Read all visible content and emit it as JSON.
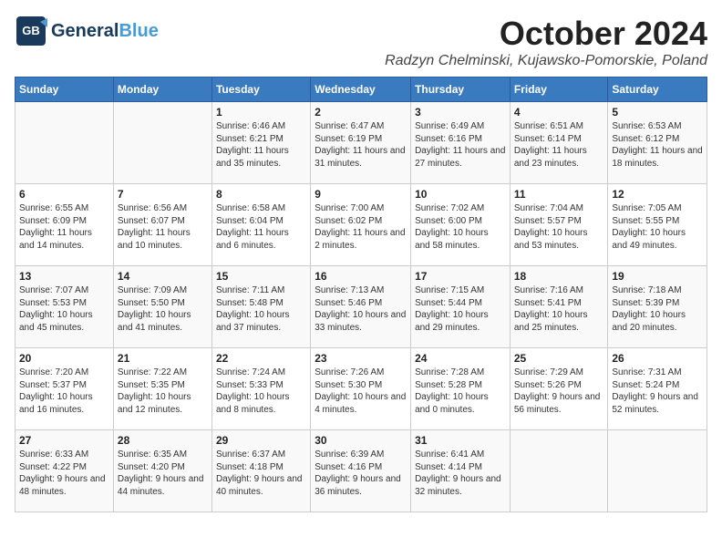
{
  "header": {
    "logo_general": "General",
    "logo_blue": "Blue",
    "main_title": "October 2024",
    "subtitle": "Radzyn Chelminski, Kujawsko-Pomorskie, Poland"
  },
  "days_of_week": [
    "Sunday",
    "Monday",
    "Tuesday",
    "Wednesday",
    "Thursday",
    "Friday",
    "Saturday"
  ],
  "weeks": [
    [
      {
        "day": "",
        "sunrise": "",
        "sunset": "",
        "daylight": ""
      },
      {
        "day": "",
        "sunrise": "",
        "sunset": "",
        "daylight": ""
      },
      {
        "day": "1",
        "sunrise": "Sunrise: 6:46 AM",
        "sunset": "Sunset: 6:21 PM",
        "daylight": "Daylight: 11 hours and 35 minutes."
      },
      {
        "day": "2",
        "sunrise": "Sunrise: 6:47 AM",
        "sunset": "Sunset: 6:19 PM",
        "daylight": "Daylight: 11 hours and 31 minutes."
      },
      {
        "day": "3",
        "sunrise": "Sunrise: 6:49 AM",
        "sunset": "Sunset: 6:16 PM",
        "daylight": "Daylight: 11 hours and 27 minutes."
      },
      {
        "day": "4",
        "sunrise": "Sunrise: 6:51 AM",
        "sunset": "Sunset: 6:14 PM",
        "daylight": "Daylight: 11 hours and 23 minutes."
      },
      {
        "day": "5",
        "sunrise": "Sunrise: 6:53 AM",
        "sunset": "Sunset: 6:12 PM",
        "daylight": "Daylight: 11 hours and 18 minutes."
      }
    ],
    [
      {
        "day": "6",
        "sunrise": "Sunrise: 6:55 AM",
        "sunset": "Sunset: 6:09 PM",
        "daylight": "Daylight: 11 hours and 14 minutes."
      },
      {
        "day": "7",
        "sunrise": "Sunrise: 6:56 AM",
        "sunset": "Sunset: 6:07 PM",
        "daylight": "Daylight: 11 hours and 10 minutes."
      },
      {
        "day": "8",
        "sunrise": "Sunrise: 6:58 AM",
        "sunset": "Sunset: 6:04 PM",
        "daylight": "Daylight: 11 hours and 6 minutes."
      },
      {
        "day": "9",
        "sunrise": "Sunrise: 7:00 AM",
        "sunset": "Sunset: 6:02 PM",
        "daylight": "Daylight: 11 hours and 2 minutes."
      },
      {
        "day": "10",
        "sunrise": "Sunrise: 7:02 AM",
        "sunset": "Sunset: 6:00 PM",
        "daylight": "Daylight: 10 hours and 58 minutes."
      },
      {
        "day": "11",
        "sunrise": "Sunrise: 7:04 AM",
        "sunset": "Sunset: 5:57 PM",
        "daylight": "Daylight: 10 hours and 53 minutes."
      },
      {
        "day": "12",
        "sunrise": "Sunrise: 7:05 AM",
        "sunset": "Sunset: 5:55 PM",
        "daylight": "Daylight: 10 hours and 49 minutes."
      }
    ],
    [
      {
        "day": "13",
        "sunrise": "Sunrise: 7:07 AM",
        "sunset": "Sunset: 5:53 PM",
        "daylight": "Daylight: 10 hours and 45 minutes."
      },
      {
        "day": "14",
        "sunrise": "Sunrise: 7:09 AM",
        "sunset": "Sunset: 5:50 PM",
        "daylight": "Daylight: 10 hours and 41 minutes."
      },
      {
        "day": "15",
        "sunrise": "Sunrise: 7:11 AM",
        "sunset": "Sunset: 5:48 PM",
        "daylight": "Daylight: 10 hours and 37 minutes."
      },
      {
        "day": "16",
        "sunrise": "Sunrise: 7:13 AM",
        "sunset": "Sunset: 5:46 PM",
        "daylight": "Daylight: 10 hours and 33 minutes."
      },
      {
        "day": "17",
        "sunrise": "Sunrise: 7:15 AM",
        "sunset": "Sunset: 5:44 PM",
        "daylight": "Daylight: 10 hours and 29 minutes."
      },
      {
        "day": "18",
        "sunrise": "Sunrise: 7:16 AM",
        "sunset": "Sunset: 5:41 PM",
        "daylight": "Daylight: 10 hours and 25 minutes."
      },
      {
        "day": "19",
        "sunrise": "Sunrise: 7:18 AM",
        "sunset": "Sunset: 5:39 PM",
        "daylight": "Daylight: 10 hours and 20 minutes."
      }
    ],
    [
      {
        "day": "20",
        "sunrise": "Sunrise: 7:20 AM",
        "sunset": "Sunset: 5:37 PM",
        "daylight": "Daylight: 10 hours and 16 minutes."
      },
      {
        "day": "21",
        "sunrise": "Sunrise: 7:22 AM",
        "sunset": "Sunset: 5:35 PM",
        "daylight": "Daylight: 10 hours and 12 minutes."
      },
      {
        "day": "22",
        "sunrise": "Sunrise: 7:24 AM",
        "sunset": "Sunset: 5:33 PM",
        "daylight": "Daylight: 10 hours and 8 minutes."
      },
      {
        "day": "23",
        "sunrise": "Sunrise: 7:26 AM",
        "sunset": "Sunset: 5:30 PM",
        "daylight": "Daylight: 10 hours and 4 minutes."
      },
      {
        "day": "24",
        "sunrise": "Sunrise: 7:28 AM",
        "sunset": "Sunset: 5:28 PM",
        "daylight": "Daylight: 10 hours and 0 minutes."
      },
      {
        "day": "25",
        "sunrise": "Sunrise: 7:29 AM",
        "sunset": "Sunset: 5:26 PM",
        "daylight": "Daylight: 9 hours and 56 minutes."
      },
      {
        "day": "26",
        "sunrise": "Sunrise: 7:31 AM",
        "sunset": "Sunset: 5:24 PM",
        "daylight": "Daylight: 9 hours and 52 minutes."
      }
    ],
    [
      {
        "day": "27",
        "sunrise": "Sunrise: 6:33 AM",
        "sunset": "Sunset: 4:22 PM",
        "daylight": "Daylight: 9 hours and 48 minutes."
      },
      {
        "day": "28",
        "sunrise": "Sunrise: 6:35 AM",
        "sunset": "Sunset: 4:20 PM",
        "daylight": "Daylight: 9 hours and 44 minutes."
      },
      {
        "day": "29",
        "sunrise": "Sunrise: 6:37 AM",
        "sunset": "Sunset: 4:18 PM",
        "daylight": "Daylight: 9 hours and 40 minutes."
      },
      {
        "day": "30",
        "sunrise": "Sunrise: 6:39 AM",
        "sunset": "Sunset: 4:16 PM",
        "daylight": "Daylight: 9 hours and 36 minutes."
      },
      {
        "day": "31",
        "sunrise": "Sunrise: 6:41 AM",
        "sunset": "Sunset: 4:14 PM",
        "daylight": "Daylight: 9 hours and 32 minutes."
      },
      {
        "day": "",
        "sunrise": "",
        "sunset": "",
        "daylight": ""
      },
      {
        "day": "",
        "sunrise": "",
        "sunset": "",
        "daylight": ""
      }
    ]
  ]
}
